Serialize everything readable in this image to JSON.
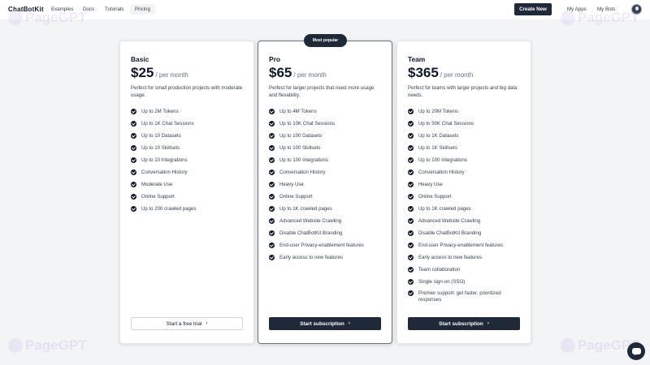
{
  "nav": {
    "brand": "ChatBotKit",
    "links": [
      "Examples",
      "Docs",
      "Tutorials",
      "Pricing"
    ],
    "create_label": "Create New",
    "my_apps": "My Apps",
    "my_bots": "My Bots"
  },
  "watermark": "PageGPT",
  "featured_badge": "Most popular",
  "plans": [
    {
      "name": "Basic",
      "price": "$25",
      "per": "/ per month",
      "description": "Perfect for small production projects with moderate usage.",
      "features": [
        "Up to 2M Tokens",
        "Up to 1K Chat Sessions",
        "Up to 10 Datasets",
        "Up to 10 Skillsets",
        "Up to 10 Integrations",
        "Conversation History",
        "Moderate Use",
        "Online Support",
        "Up to 200 crawled pages"
      ],
      "cta": "Start a free trial"
    },
    {
      "name": "Pro",
      "price": "$65",
      "per": "/ per month",
      "description": "Perfect for larger projects that need more usage and flexability.",
      "features": [
        "Up to 4M Tokens",
        "Up to 10K Chat Sessions",
        "Up to 100 Datasets",
        "Up to 100 Skillsets",
        "Up to 100 Integrations",
        "Conversation History",
        "Heavy Use",
        "Online Support",
        "Up to 1K crawled pages",
        "Advanced Website Crawling",
        "Disable ChatBotKit Branding",
        "End-user Privacy-enablement features",
        "Early access to new features"
      ],
      "cta": "Start subscription"
    },
    {
      "name": "Team",
      "price": "$365",
      "per": "/ per month",
      "description": "Perfect for teams with larger projects and big data needs.",
      "features": [
        "Up to 20M Tokens",
        "Up to 50K Chat Sessions",
        "Up to 1K Datasets",
        "Up to 1K Skillsets",
        "Up to 100 Integrations",
        "Conversation History",
        "Heavy Use",
        "Online Support",
        "Up to 1K crawled pages",
        "Advanced Website Crawling",
        "Disable ChatBotKit Branding",
        "End-user Privacy-enablement features",
        "Early access to new features",
        "Team collaboration",
        "Single sign-on (SSO)",
        "Premier support: get faster, prioritized responses"
      ],
      "cta": "Start subscription"
    }
  ],
  "colors": {
    "accent": "#1f2937",
    "background": "#f3f4f6",
    "card": "#ffffff"
  },
  "icons": {
    "feature": "check-circle-icon",
    "cta": "chevron-right-icon",
    "fab": "chat-bubble-icon"
  }
}
